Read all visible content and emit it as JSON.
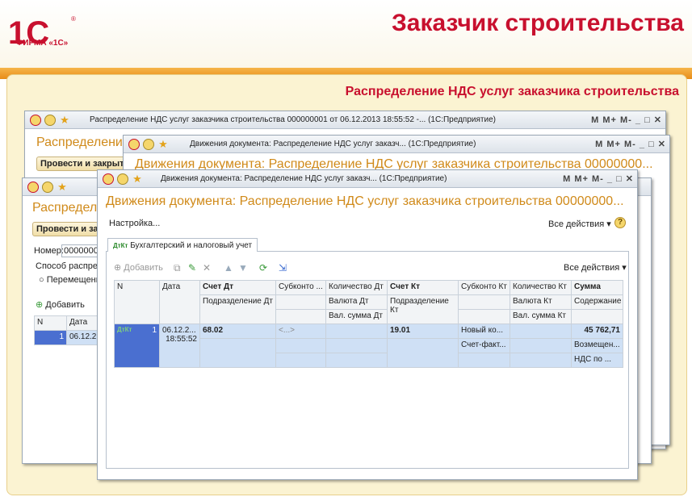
{
  "slide": {
    "logo": "1С",
    "logo_caption": "ФИРМА «1С»",
    "title": "Заказчик строительства",
    "subtitle": "Распределение НДС услуг заказчика строительства"
  },
  "colors": {
    "brand": "#c8102e",
    "accent": "#e78c18",
    "heading": "#d08a1a",
    "selection": "#cfe0f5"
  },
  "window_back": {
    "title": "Распределение НДС услуг заказчика строительства 000000001 от 06.12.2013 18:55:52 -... (1С:Предприятие)",
    "heading": "Распределени",
    "post_button": "Провести и закрыть"
  },
  "window_mid": {
    "title": "Движения документа: Распределение НДС услуг заказч... (1С:Предприятие)",
    "heading": "Движения документа: Распределение НДС услуг заказчика строительства 00000000..."
  },
  "window_left": {
    "heading": "Распределе",
    "post_button": "Провести и закрыть",
    "number_label": "Номер:",
    "number_value": "00000000",
    "method_label": "Способ распреде",
    "radio_label": "Перемещени",
    "add_button": "Добавить",
    "col_n": "N",
    "col_date": "Дата",
    "row_n": "1",
    "row_date": "06.12.2"
  },
  "window_front": {
    "title": "Движения документа: Распределение НДС услуг заказч... (1С:Предприятие)",
    "heading": "Движения документа: Распределение НДС услуг заказчика строительства 00000000...",
    "settings_link": "Настройка...",
    "all_actions": "Все действия",
    "help": "?",
    "tab_label": "Бухгалтерский и налоговый учет",
    "tab_icon": "Дт Кт",
    "add_button": "Добавить",
    "grid_all_actions": "Все действия",
    "columns": {
      "n": "N",
      "date": "Дата",
      "dt_account": "Счет Дт",
      "dt_subdiv": "Подразделение Дт",
      "dt_subconto": "Субконто ...",
      "dt_qty": "Количество Дт",
      "dt_currency": "Валюта Дт",
      "dt_cur_amount": "Вал. сумма Дт",
      "kt_account": "Счет Кт",
      "kt_subdiv": "Подразделение Кт",
      "kt_subconto": "Субконто Кт",
      "kt_qty": "Количество Кт",
      "kt_currency": "Валюта Кт",
      "kt_cur_amount": "Вал. сумма Кт",
      "amount": "Сумма",
      "content": "Содержание"
    },
    "row": {
      "n": "1",
      "date": "06.12.2...",
      "time": "18:55:52",
      "dt_account": "68.02",
      "dt_subconto": "<...>",
      "kt_account": "19.01",
      "kt_subconto1": "Новый ко...",
      "kt_subconto2": "Счет-факт...",
      "amount": "45 762,71",
      "content1": "Возмещен...",
      "content2": "НДС по ..."
    }
  }
}
